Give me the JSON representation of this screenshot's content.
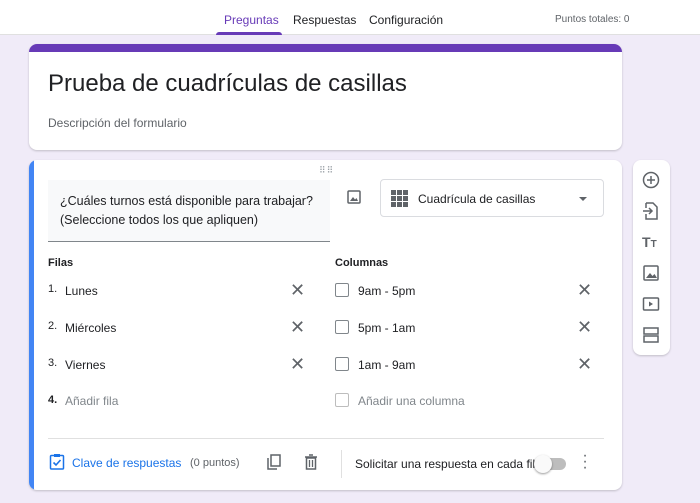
{
  "nav": {
    "tabs": [
      "Preguntas",
      "Respuestas",
      "Configuración"
    ],
    "points": "Puntos totales: 0"
  },
  "form": {
    "title": "Prueba de cuadrículas de casillas",
    "description": "Descripción del formulario"
  },
  "question": {
    "text": "¿Cuáles turnos está disponible para trabajar? (Seleccione todos los que apliquen)",
    "type": "Cuadrícula de casillas",
    "rows_label": "Filas",
    "columns_label": "Columnas",
    "rows": [
      {
        "n": "1.",
        "label": "Lunes"
      },
      {
        "n": "2.",
        "label": "Miércoles"
      },
      {
        "n": "3.",
        "label": "Viernes"
      }
    ],
    "add_row_n": "4.",
    "add_row": "Añadir fila",
    "columns": [
      "9am - 5pm",
      "5pm - 1am",
      "1am - 9am"
    ],
    "add_column": "Añadir una columna"
  },
  "footer": {
    "answer_key": "Clave de respuestas",
    "points": "(0 puntos)",
    "require": "Solicitar una respuesta en cada fila",
    "require_on": false
  },
  "colors": {
    "accent": "#673ab7",
    "blue": "#4285f4",
    "bg": "#f0ebf8"
  }
}
